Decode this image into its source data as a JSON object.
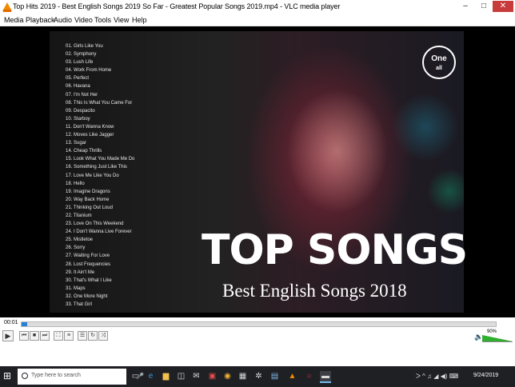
{
  "window": {
    "title": "Top Hits 2019 - Best English Songs 2019 So Far - Greatest Popular Songs 2019.mp4 - VLC media player",
    "controls": [
      "–",
      "□",
      "✕"
    ]
  },
  "menu": [
    "Media",
    "Playback",
    "Audio",
    "Video",
    "Tools",
    "View",
    "Help"
  ],
  "video": {
    "songs": [
      "01. Girls Like You",
      "02. Symphony",
      "03. Lush Life",
      "04. Work From Home",
      "05. Perfect",
      "06. Havana",
      "07. I'm Not Her",
      "08. This Is What You Came For",
      "09. Despacito",
      "10. Starboy",
      "11. Don't Wanna Know",
      "12. Moves Like Jagger",
      "13. Sugar",
      "14. Cheap Thrills",
      "15. Look What You Made Me Do",
      "16. Something Just Like This",
      "17. Love Me Like You Do",
      "18. Hello",
      "19. Imagine Dragons",
      "20. Way Back Home",
      "21. Thinking Out Loud",
      "22. Titanium",
      "23. Love On This Weekend",
      "24. I Don't Wanna Live Forever",
      "25. Mistletoe",
      "26. Sorry",
      "27. Waiting For Love",
      "28. Lost Frequencies",
      "29. It Ain't Me",
      "30. That's What I Like",
      "31. Maps",
      "32. One More Night",
      "33. That Girl"
    ],
    "logo_main": "One",
    "logo_sub": "all",
    "headline": "TOP SONGS",
    "subheadline": "Best English Songs 2018"
  },
  "seek": {
    "elapsed": "00:01",
    "total": "",
    "progress": 0.012,
    "fill_color": "#2c7fd6"
  },
  "player_buttons": [
    {
      "name": "play-button",
      "glyph": "▶"
    },
    {
      "name": "previous-button",
      "glyph": "⏮"
    },
    {
      "name": "stop-button",
      "glyph": "■"
    },
    {
      "name": "next-button",
      "glyph": "⏭"
    },
    {
      "name": "fullscreen-button",
      "glyph": "⛶"
    },
    {
      "name": "extended-settings-button",
      "glyph": "≡"
    },
    {
      "name": "playlist-button",
      "glyph": "☰"
    },
    {
      "name": "loop-button",
      "glyph": "↻"
    },
    {
      "name": "shuffle-button",
      "glyph": "⤨"
    }
  ],
  "volume": {
    "label": "90%",
    "level": 0.9
  },
  "taskbar": {
    "search_placeholder": "Type here to search",
    "icons": [
      "task-view-icon",
      "edge-icon",
      "file-explorer-icon",
      "store-icon",
      "mail-icon",
      "photos-icon",
      "chrome-icon",
      "calculator-icon",
      "settings-icon",
      "notepad-icon",
      "vlc-icon",
      "opera-icon",
      "explorer-window-icon"
    ],
    "clock": "9/24/2019"
  }
}
